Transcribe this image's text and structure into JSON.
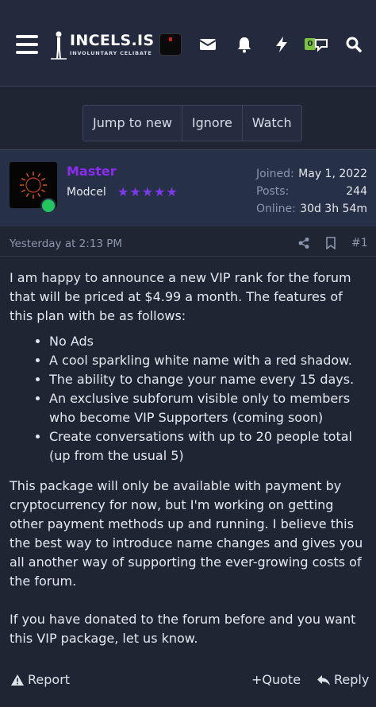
{
  "header": {
    "logo_title": "INCELS.IS",
    "logo_subtitle": "INVOLUNTARY CELIBATE",
    "messages_badge": "0",
    "icons": [
      "menu-icon",
      "envelope-icon",
      "bell-icon",
      "lightning-icon",
      "conversations-icon",
      "search-icon"
    ]
  },
  "thread_actions": {
    "jump_label": "Jump to new",
    "ignore_label": "Ignore",
    "watch_label": "Watch"
  },
  "user": {
    "name": "Master",
    "title": "Modcel",
    "stars": "★★★★★",
    "joined_label": "Joined:",
    "joined_value": "May 1, 2022",
    "posts_label": "Posts:",
    "posts_value": "244",
    "online_label": "Online:",
    "online_value": "30d 3h 54m",
    "name_color": "#8b2cf0",
    "online_status_color": "#22c55e"
  },
  "post": {
    "date": "Yesterday at 2:13 PM",
    "number": "#1",
    "intro": "I am happy to announce a new VIP rank for the forum that will be priced at $4.99 a month. The features of this plan with be as follows:",
    "features": [
      "No Ads",
      "A cool sparkling white name with a red shadow.",
      "The ability to change your name every 15 days.",
      "An exclusive subforum visible only to members who become VIP Supporters (coming soon)",
      "Create conversations with up to 20 people total (up from the usual 5)"
    ],
    "paragraph2": "This package will only be available with payment by cryptocurrency for now, but I'm working on getting other payment methods up and running. I believe this the best way to introduce name changes and gives you all another way of supporting the ever-growing costs of the forum.",
    "paragraph3": "If you have donated to the forum before and you want this VIP package, let us know."
  },
  "post_actions": {
    "report_label": "Report",
    "quote_label": "+Quote",
    "reply_label": "Reply"
  }
}
